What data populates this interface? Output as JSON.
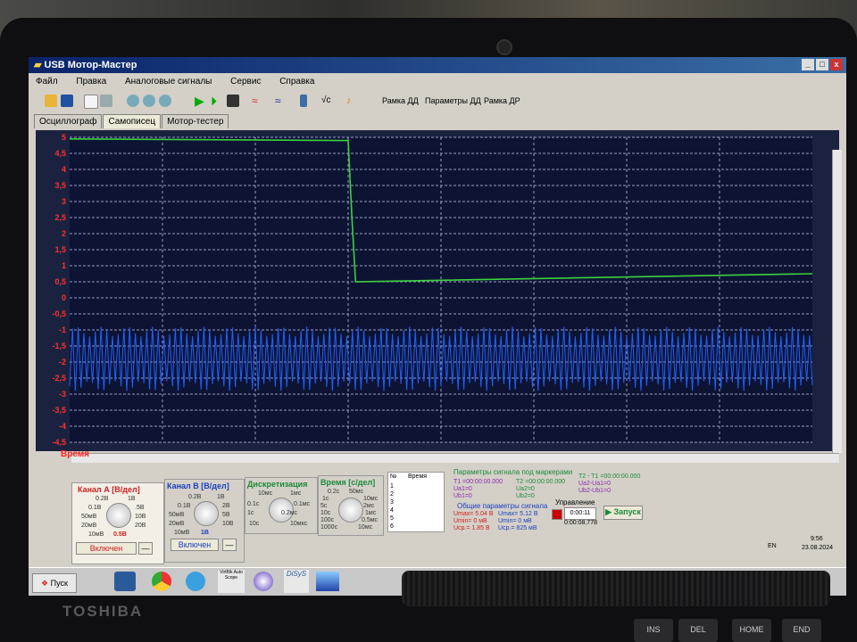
{
  "window": {
    "title": "USB Мотор-Мастер"
  },
  "menu": [
    "Файл",
    "Правка",
    "Аналоговые сигналы",
    "Сервис",
    "Справка"
  ],
  "toolbar": {
    "frame_dd": "Рамка ДД",
    "params_dd": "Параметры ДД",
    "frame_dr": "Рамка ДР"
  },
  "tabs": [
    "Осциллограф",
    "Самописец",
    "Мотор-тестер"
  ],
  "chart_data": {
    "type": "line",
    "ylim": [
      -4.5,
      5
    ],
    "y_ticks": [
      "5",
      "4,5",
      "4",
      "3,5",
      "3",
      "2,5",
      "2",
      "1,5",
      "1",
      "0,5",
      "0",
      "-0,5",
      "-1",
      "-1,5",
      "-2",
      "-2,5",
      "-3",
      "-3,5",
      "-4",
      "-4,5"
    ],
    "xlabel": "Время",
    "series": [
      {
        "color": "#3cd03c",
        "x": [
          0,
          0.375,
          0.38,
          0.385,
          1.0
        ],
        "y": [
          4.95,
          4.9,
          2.5,
          0.5,
          0.75
        ]
      },
      {
        "color": "#2060ff",
        "kind": "oscillation",
        "y_center": -1.9,
        "amplitude": 1.0
      }
    ],
    "grid": true
  },
  "channel_a": {
    "title": "Канал А [В/дел]",
    "ticks": [
      "0.2В",
      "1В",
      "0.1В",
      ".5В",
      "50мВ",
      "10В",
      "20мВ",
      "20В",
      "10мВ"
    ],
    "value": "0.5В",
    "state": "Включен"
  },
  "channel_b": {
    "title": "Канал В [В/дел]",
    "ticks": [
      "0.2В",
      "1В",
      "0.1В",
      "2В",
      "50мВ",
      "5В",
      "20мВ",
      "10В",
      "10мВ"
    ],
    "value": "1В",
    "state": "Включен"
  },
  "discretization": {
    "title": "Дискретизация",
    "ticks": [
      "10мс",
      "1мс",
      "0.1с",
      "0.1мс",
      "1с",
      "0.2мс",
      "10с",
      "10мкс"
    ]
  },
  "time_div": {
    "title": "Время [с/дел]",
    "ticks": [
      "0.2с",
      "50мс",
      "1с",
      "10мс",
      "5с",
      "2мс",
      "10с",
      "1мс",
      "100с",
      "0.5мс",
      "1000с",
      "10мс"
    ]
  },
  "list": {
    "col_n": "№",
    "col_time": "Время",
    "rows": [
      "1",
      "2",
      "3",
      "4",
      "5",
      "6"
    ]
  },
  "markers": {
    "title": "Параметры сигнала под маркерами",
    "t1": "T1 =00:00:00.000",
    "t2": "T2 =00:00:00.000",
    "t21": "T2 - T1 =00:00:00.000",
    "ua1": "Ua1=0",
    "ub1": "Ub1=0",
    "ua2": "Ua2=0",
    "ub2": "Ub2=0",
    "uaua": "Ua2-Ua1=0",
    "ubub": "Ub2-Ub1=0"
  },
  "general": {
    "title": "Общие параметры сигнала",
    "a_max": "Umax= 5.04 В",
    "a_min": "Umin= 0 мВ",
    "a_avg": "Ucp.= 1.85 В",
    "b_max": "Umax= 5.12 В",
    "b_min": "Umin= 0 мВ",
    "b_avg": "Ucp.= 825 мВ"
  },
  "control": {
    "title": "Управление",
    "time1": "0:00:11",
    "time2": "0:00:08.778",
    "start": "Запуск"
  },
  "tray": {
    "lang": "EN",
    "time": "9:56",
    "date": "23.08.2024"
  },
  "taskbar": {
    "start": "Пуск",
    "app1": "VirtBlk Auto Scope",
    "app2": "DiSyS"
  },
  "brand": "TOSHIBA",
  "keys": [
    "INS",
    "DEL",
    "HOME",
    "END"
  ]
}
